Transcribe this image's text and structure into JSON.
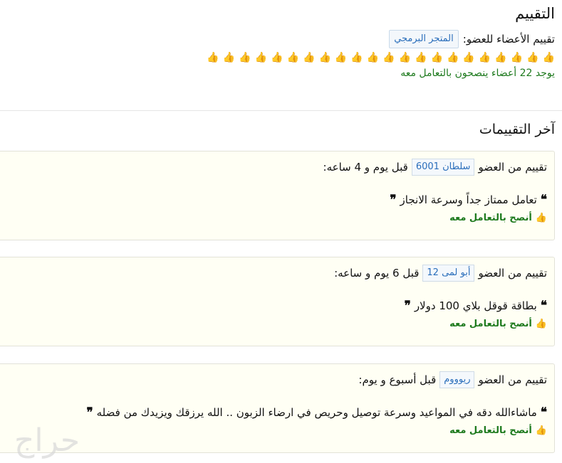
{
  "header": {
    "title": "التقييم",
    "member_rating_label": "تقييم الأعضاء للعضو:",
    "member_name": "المتجر البرمجي",
    "recommend_count_text": "يوجد 22 أعضاء ينصحون بالتعامل معه",
    "thumb_count": 22
  },
  "reviews_section": {
    "title": "آخر التقييمات",
    "reviews": [
      {
        "prefix": "تقييم من العضو",
        "reviewer": "سلطان 6001",
        "time": "قبل يوم و 4 ساعه:",
        "quote": "تعامل ممتاز جداً وسرعة الانجاز",
        "recommend": "أنصح بالتعامل معه"
      },
      {
        "prefix": "تقييم من العضو",
        "reviewer": "أبو لمى 12",
        "time": "قبل 6 يوم و ساعه:",
        "quote": "بطاقة قوقل بلاي 100 دولار",
        "recommend": "أنصح بالتعامل معه"
      },
      {
        "prefix": "تقييم من العضو",
        "reviewer": "ريوووم",
        "time": "قبل أسبوع و يوم:",
        "quote": "ماشاءالله دقه في المواعيد وسرعة توصيل وحريص في ارضاء الزبون .. الله يرزقك ويزيدك من فضله",
        "recommend": "أنصح بالتعامل معه"
      }
    ]
  },
  "icons": {
    "thumb": "thumbs-up-icon",
    "quote": "quote-icon"
  },
  "colors": {
    "recommend_green": "#1e7a1e",
    "link_blue": "#2a6ebb",
    "card_bg": "#fffff4"
  },
  "watermark": "حراج"
}
